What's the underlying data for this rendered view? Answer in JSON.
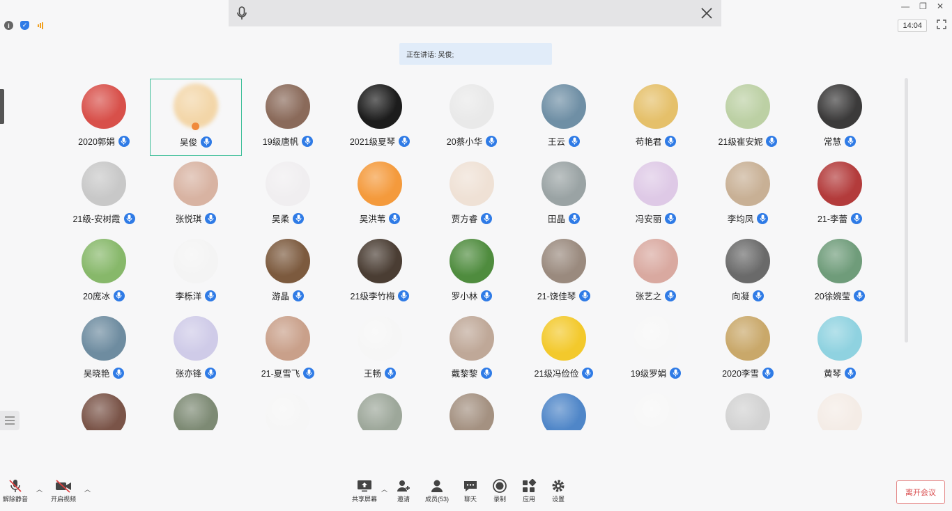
{
  "top_bar": {
    "time": "14:04",
    "mic_icon": "microphone-icon",
    "close_icon": "close-icon"
  },
  "speaking_banner": "正在讲话: 吴俊;",
  "participants": [
    {
      "name": "2020郭娟",
      "color": "#d8504a"
    },
    {
      "name": "吴俊",
      "color": "#f3d6a8",
      "active": true,
      "host": true
    },
    {
      "name": "19级唐帆",
      "color": "#8a6a5a"
    },
    {
      "name": "2021级夏琴",
      "color": "#1c1c1c"
    },
    {
      "name": "20蔡小华",
      "color": "#e9e9e9"
    },
    {
      "name": "王云",
      "color": "#6f8fa5"
    },
    {
      "name": "苟艳君",
      "color": "#e5c06a"
    },
    {
      "name": "21级崔安妮",
      "color": "#bcd0a4"
    },
    {
      "name": "常慧",
      "color": "#3b3a3a"
    },
    {
      "name": "21级-安树霞",
      "color": "#c8c8c8"
    },
    {
      "name": "张悦琪",
      "color": "#d8b3a2"
    },
    {
      "name": "吴柔",
      "color": "#f0eef0"
    },
    {
      "name": "吴洪苇",
      "color": "#f49a3c"
    },
    {
      "name": "贾方睿",
      "color": "#efe1d5"
    },
    {
      "name": "田晶",
      "color": "#9aa3a4"
    },
    {
      "name": "冯安丽",
      "color": "#dec9e6"
    },
    {
      "name": "李均凤",
      "color": "#c8b095"
    },
    {
      "name": "21-李蕾",
      "color": "#b33b3b"
    },
    {
      "name": "20庞冰",
      "color": "#87b86a"
    },
    {
      "name": "李栎洋",
      "color": "#f4f4f4"
    },
    {
      "name": "游晶",
      "color": "#7c5a3e"
    },
    {
      "name": "21级李竹梅",
      "color": "#4a3d33"
    },
    {
      "name": "罗小林",
      "color": "#4f8c3e"
    },
    {
      "name": "21-饶佳琴",
      "color": "#9a8a7e"
    },
    {
      "name": "张艺之",
      "color": "#d9a9a0"
    },
    {
      "name": "向凝",
      "color": "#6a6a6a"
    },
    {
      "name": "20徐婉莹",
      "color": "#6f9c7a"
    },
    {
      "name": "吴晓艳",
      "color": "#6e8ca0"
    },
    {
      "name": "张亦锋",
      "color": "#cfcbe8"
    },
    {
      "name": "21-夏雪飞",
      "color": "#c9a08a"
    },
    {
      "name": "王畅",
      "color": "#f6f6f6"
    },
    {
      "name": "戴黎黎",
      "color": "#bfa898"
    },
    {
      "name": "21级冯俭俭",
      "color": "#f3c92c"
    },
    {
      "name": "19级罗娟",
      "color": "#f7f7f7"
    },
    {
      "name": "2020李雪",
      "color": "#c9a86a"
    },
    {
      "name": "黄琴",
      "color": "#8fd2e0"
    },
    {
      "name": "",
      "color": "#7a5448"
    },
    {
      "name": "",
      "color": "#7d8a74"
    },
    {
      "name": "",
      "color": "#f6f6f6"
    },
    {
      "name": "",
      "color": "#9da79a"
    },
    {
      "name": "",
      "color": "#a49181"
    },
    {
      "name": "",
      "color": "#4f86c8"
    },
    {
      "name": "",
      "color": "#f7f7f7"
    },
    {
      "name": "",
      "color": "#d2d2d2"
    },
    {
      "name": "",
      "color": "#f4ece6"
    }
  ],
  "toolbar": {
    "unmute": "解除静音",
    "start_video": "开启视频",
    "share_screen": "共享屏幕",
    "invite": "邀请",
    "members": "成员(53)",
    "chat": "聊天",
    "record": "录制",
    "apps": "应用",
    "settings": "设置",
    "leave": "离开会议"
  }
}
